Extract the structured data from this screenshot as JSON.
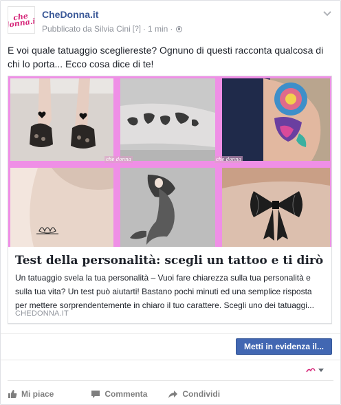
{
  "post": {
    "page_name": "CheDonna.it",
    "published_by": "Pubblicato da Silvia Cini",
    "help_marker": "[?]",
    "time": "1 min",
    "separator": "·",
    "avatar_logo_text": "che\ndonna.it",
    "text": "E voi quale tatuaggio scegliereste? Ognuno di questi racconta qualcosa di chi lo porta... Ecco cosa dice di te!"
  },
  "link_preview": {
    "title": "Test della personalità: scegli un tattoo e ti dirò chi sei",
    "description": "Un tatuaggio svela la tua personalità – Vuoi fare chiarezza sulla tua personalità e sulla tua vita? Un test può aiutarti! Bastano pochi minuti ed una semplice risposta per mettere sorprendentemente in chiaro il tuo carattere. Scegli uno dei tatuaggi...",
    "domain": "CHEDONNA.IT",
    "image_watermark": "che donna"
  },
  "boost": {
    "label": "Metti in evidenza il..."
  },
  "actions": {
    "like": "Mi piace",
    "comment": "Commenta",
    "share": "Condividi"
  },
  "icons": {
    "chevron": "chevron-down-icon",
    "globe": "globe-icon",
    "like": "thumbs-up-icon",
    "comment": "comment-icon",
    "share": "share-arrow-icon"
  },
  "colors": {
    "link_blue": "#3b5998",
    "button_blue": "#4267b2",
    "brand_pink": "#d6287a",
    "collage_pink": "#ef8fe6",
    "meta_grey": "#90949c"
  }
}
